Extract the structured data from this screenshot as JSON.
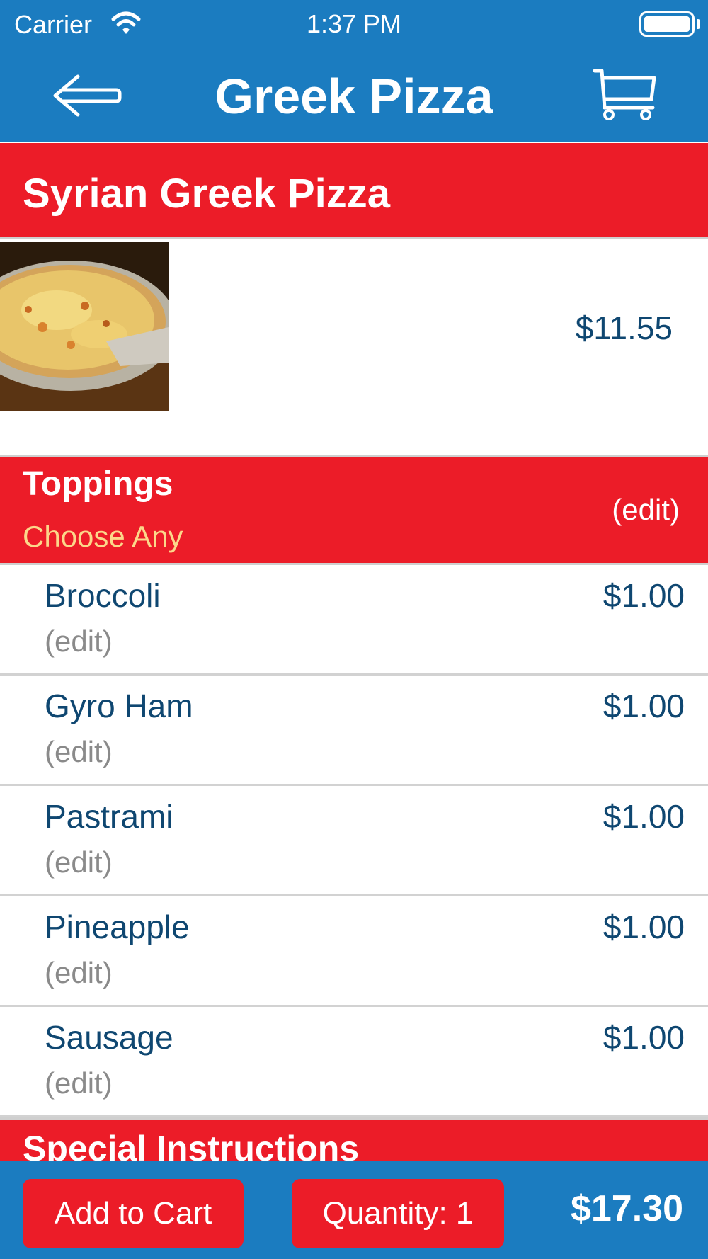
{
  "status_bar": {
    "carrier": "Carrier",
    "time": "1:37 PM"
  },
  "nav": {
    "title": "Greek Pizza",
    "back_icon": "back-arrow-icon",
    "cart_icon": "cart-icon"
  },
  "item": {
    "name": "Syrian Greek Pizza",
    "price": "$11.55"
  },
  "toppings": {
    "title": "Toppings",
    "subtitle": "Choose Any",
    "edit_label": "(edit)",
    "items": [
      {
        "name": "Broccoli",
        "price": "$1.00",
        "edit": "(edit)"
      },
      {
        "name": "Gyro Ham",
        "price": "$1.00",
        "edit": "(edit)"
      },
      {
        "name": "Pastrami",
        "price": "$1.00",
        "edit": "(edit)"
      },
      {
        "name": "Pineapple",
        "price": "$1.00",
        "edit": "(edit)"
      },
      {
        "name": "Sausage",
        "price": "$1.00",
        "edit": "(edit)"
      }
    ]
  },
  "special_instructions": {
    "title": "Special Instructions"
  },
  "footer": {
    "add_to_cart": "Add to Cart",
    "quantity": "Quantity: 1",
    "total": "$17.30"
  },
  "colors": {
    "nav_blue": "#1b7cc0",
    "header_red": "#ec1c28",
    "text_navy": "#0f4771",
    "subtitle_yellow": "#fcd78a",
    "edit_gray": "#8a8a8a"
  }
}
